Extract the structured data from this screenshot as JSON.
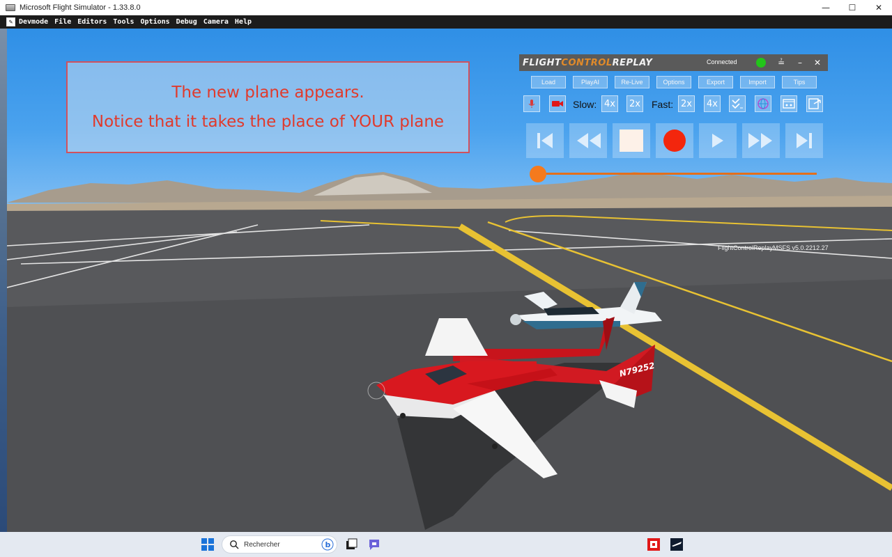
{
  "window": {
    "title": "Microsoft Flight Simulator - 1.33.8.0",
    "minimize_glyph": "—",
    "maximize_glyph": "☐",
    "close_glyph": "✕"
  },
  "menubar": {
    "items": [
      "Devmode",
      "File",
      "Editors",
      "Tools",
      "Options",
      "Debug",
      "Camera",
      "Help"
    ]
  },
  "annotation": {
    "line1": "The new plane appears.",
    "line2": "Notice that it takes the place of  YOUR plane"
  },
  "fcr_panel": {
    "logo_parts": [
      "FLIGHT",
      "CONTROL",
      "REPLAY"
    ],
    "status": "Connected",
    "status_color": "#22c51a",
    "menu_buttons": [
      "Load",
      "PlayAI",
      "Re-Live",
      "Options",
      "Export",
      "Import",
      "Tips"
    ],
    "slow_label": "Slow:",
    "slow_options": [
      "4x",
      "2x"
    ],
    "fast_label": "Fast:",
    "fast_options": [
      "2x",
      "4x"
    ],
    "version": "FlightControlReplayMSFS v5.0.2212.27",
    "playback_position": 0.0,
    "accent_color": "#f57a1d"
  },
  "aircraft": {
    "registration": "N79252"
  },
  "taskbar": {
    "search_placeholder": "Rechercher"
  }
}
